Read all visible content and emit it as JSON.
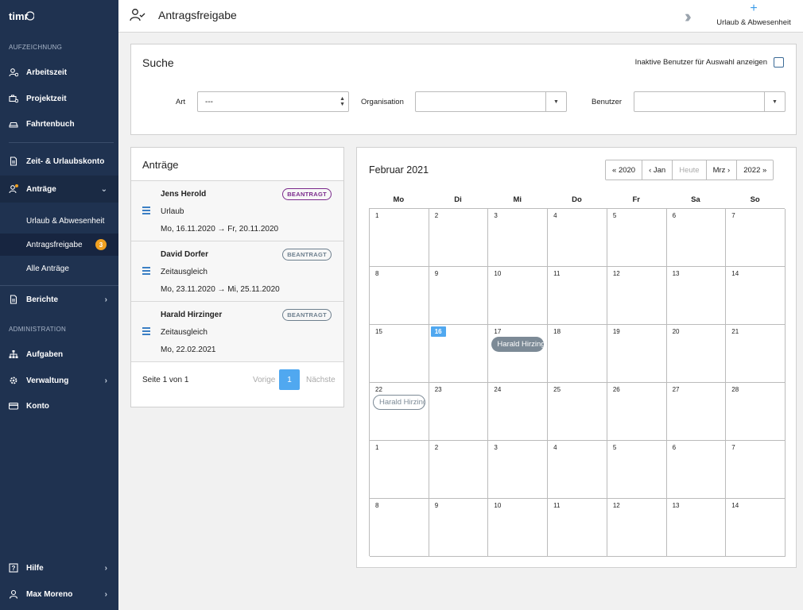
{
  "app": {
    "logo_text": "timr"
  },
  "sidebar": {
    "section_recording": "AUFZEICHNUNG",
    "section_admin": "ADMINISTRATION",
    "items": {
      "arbeitszeit": "Arbeitszeit",
      "projektzeit": "Projektzeit",
      "fahrtenbuch": "Fahrtenbuch",
      "konto": "Zeit- & Urlaubskonto",
      "antraege": "Anträge",
      "urlaub": "Urlaub & Abwesenheit",
      "antragsfreigabe": "Antragsfreigabe",
      "antragsfreigabe_badge": "3",
      "alle_antraege": "Alle Anträge",
      "berichte": "Berichte",
      "aufgaben": "Aufgaben",
      "verwaltung": "Verwaltung",
      "konto2": "Konto",
      "hilfe": "Hilfe",
      "user": "Max Moreno"
    }
  },
  "header": {
    "title": "Antragsfreigabe",
    "add_label": "Urlaub & Abwesenheit"
  },
  "search": {
    "title": "Suche",
    "inactive_label": "Inaktive Benutzer für Auswahl anzeigen",
    "art_label": "Art",
    "art_value": "---",
    "org_label": "Organisation",
    "org_value": "",
    "user_label": "Benutzer",
    "user_value": ""
  },
  "requests": {
    "title": "Anträge",
    "items": [
      {
        "name": "Jens Herold",
        "type": "Urlaub",
        "dates": "Mo, 16.11.2020 → Fr, 20.11.2020",
        "status": "BEANTRAGT"
      },
      {
        "name": "David Dorfer",
        "type": "Zeitausgleich",
        "dates": "Mo, 23.11.2020 → Mi, 25.11.2020",
        "status": "BEANTRAGT"
      },
      {
        "name": "Harald Hirzinger",
        "type": "Zeitausgleich",
        "dates": "Mo, 22.02.2021",
        "status": "BEANTRAGT"
      }
    ],
    "pager": {
      "info": "Seite 1 von 1",
      "prev": "Vorige",
      "page": "1",
      "next": "Nächste"
    }
  },
  "calendar": {
    "month": "Februar 2021",
    "nav": {
      "prev_year": "2020",
      "prev_month": "Jan",
      "today": "Heute",
      "next_month": "Mrz",
      "next_year": "2022"
    },
    "weekdays": [
      "Mo",
      "Di",
      "Mi",
      "Do",
      "Fr",
      "Sa",
      "So"
    ],
    "days": [
      "1",
      "2",
      "3",
      "4",
      "5",
      "6",
      "7",
      "8",
      "9",
      "10",
      "11",
      "12",
      "13",
      "14",
      "15",
      "16",
      "17",
      "18",
      "19",
      "20",
      "21",
      "22",
      "23",
      "24",
      "25",
      "26",
      "27",
      "28",
      "1",
      "2",
      "3",
      "4",
      "5",
      "6",
      "7",
      "8",
      "9",
      "10",
      "11",
      "12",
      "13",
      "14"
    ],
    "today_index": 15,
    "events": [
      {
        "label": "Harald Hirzinger",
        "cell": 16,
        "style": "filled"
      },
      {
        "label": "Harald Hirzinger",
        "cell": 21,
        "style": "outline"
      }
    ]
  },
  "colors": {
    "sidebar": "#1f3250",
    "accent": "#50a8f0",
    "badge": "#f0a020",
    "status_purple": "#7b2a8c",
    "status_gray": "#6d7f8e"
  }
}
